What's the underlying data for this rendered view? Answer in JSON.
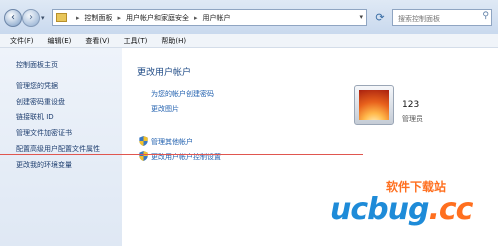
{
  "address_bar": {
    "crumbs": [
      "控制面板",
      "用户帐户和家庭安全",
      "用户帐户"
    ],
    "search_placeholder": "搜索控制面板"
  },
  "menu": [
    "文件(F)",
    "编辑(E)",
    "查看(V)",
    "工具(T)",
    "帮助(H)"
  ],
  "left_nav": [
    "控制面板主页",
    "管理您的凭据",
    "创建密码重设盘",
    "链接联机 ID",
    "管理文件加密证书",
    "配置高级用户配置文件属性",
    "更改我的环境变量"
  ],
  "main": {
    "title": "更改用户帐户",
    "links": [
      "为您的帐户创建密码",
      "更改图片"
    ],
    "shield_links": [
      "管理其他帐户",
      "更改用户帐户控制设置"
    ]
  },
  "user": {
    "name": "123",
    "role": "管理员"
  },
  "watermark": {
    "top": "软件下载站",
    "logo_a": "ucbug",
    "logo_b": ".cc"
  },
  "colors": {
    "accent_link": "#1f5fae",
    "annotation_line": "#e0564f",
    "watermark_orange": "#ff6f1f",
    "watermark_blue": "#1e8bd8"
  }
}
